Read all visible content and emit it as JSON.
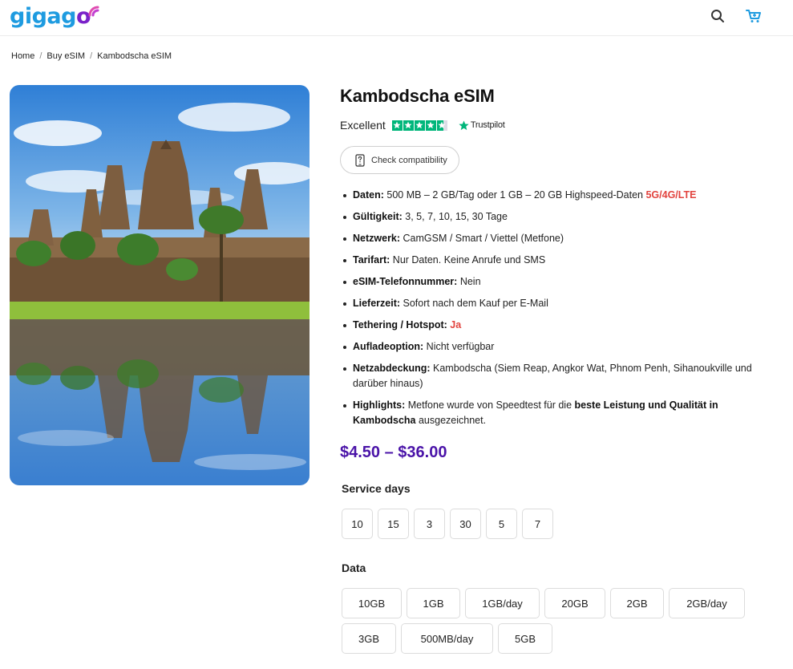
{
  "header": {
    "logo_text": "gigago",
    "logo_main": "gigag",
    "logo_o": "o",
    "search_icon": "search-icon",
    "cart_icon": "cart-icon"
  },
  "breadcrumb": {
    "items": [
      "Home",
      "Buy eSIM",
      "Kambodscha eSIM"
    ],
    "separator": "/"
  },
  "product": {
    "image_alt": "Angkor Wat reflected in a pond",
    "title": "Kambodscha eSIM",
    "rating_word": "Excellent",
    "rating_stars": 4.5,
    "trustpilot_label": "Trustpilot",
    "compatibility_button": "Check compatibility",
    "features": [
      {
        "label": "Daten:",
        "text": " 500 MB – 2 GB/Tag oder 1 GB – 20 GB Highspeed-Daten ",
        "highlight": "5G/4G/LTE"
      },
      {
        "label": "Gültigkeit:",
        "text": " 3, 5, 7, 10, 15, 30 Tage"
      },
      {
        "label": "Netzwerk:",
        "text": " CamGSM / Smart / Viettel (Metfone)"
      },
      {
        "label": "Tarifart:",
        "text": " Nur Daten. Keine Anrufe und SMS"
      },
      {
        "label": "eSIM-Telefonnummer:",
        "text": " Nein"
      },
      {
        "label": "Lieferzeit:",
        "text": " Sofort nach dem Kauf per E-Mail"
      },
      {
        "label": "Tethering / Hotspot:",
        "text": " ",
        "highlight": "Ja"
      },
      {
        "label": "Aufladeoption:",
        "text": " Nicht verfügbar"
      },
      {
        "label": "Netzabdeckung:",
        "text": " Kambodscha (Siem Reap, Angkor Wat, Phnom Penh, Sihanoukville und darüber hinaus)"
      },
      {
        "label": "Highlights:",
        "text": " Metfone wurde von Speedtest für die ",
        "bold2": "beste Leistung und Qualität in Kambodscha",
        "text2": " ausgezeichnet."
      }
    ],
    "price": "$4.50 – $36.00"
  },
  "service_days": {
    "label": "Service days",
    "options": [
      "10",
      "15",
      "3",
      "30",
      "5",
      "7"
    ]
  },
  "data_options": {
    "label": "Data",
    "options": [
      "10GB",
      "1GB",
      "1GB/day",
      "20GB",
      "2GB",
      "2GB/day",
      "3GB",
      "500MB/day",
      "5GB"
    ]
  },
  "colors": {
    "brand_blue": "#1e9be0",
    "brand_purple": "#7a22c9",
    "price": "#4a13a8",
    "highlight_red": "#e2443f",
    "trustpilot_green": "#00b67a"
  }
}
